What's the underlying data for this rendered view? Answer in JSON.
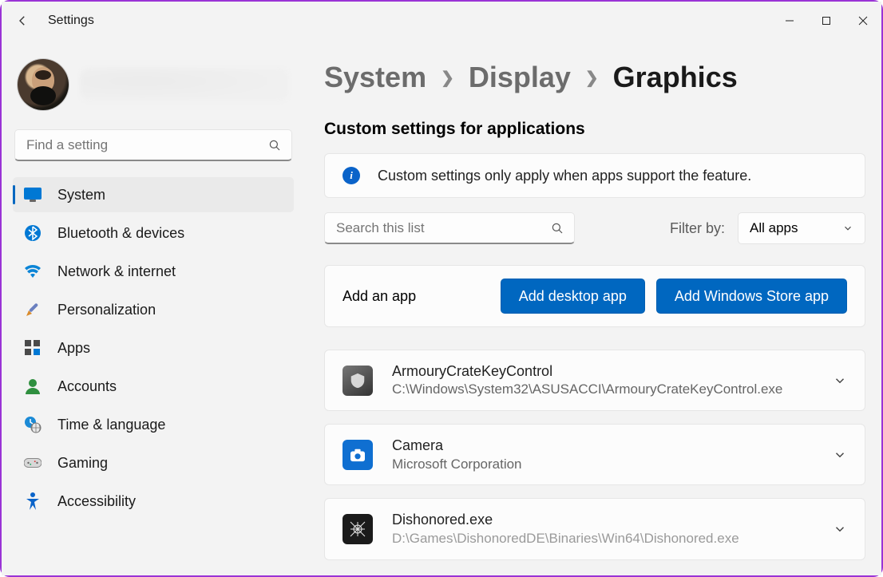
{
  "window": {
    "title": "Settings"
  },
  "search": {
    "placeholder": "Find a setting"
  },
  "sidebar": {
    "items": [
      {
        "id": "system",
        "label": "System",
        "selected": true
      },
      {
        "id": "bluetooth",
        "label": "Bluetooth & devices",
        "selected": false
      },
      {
        "id": "network",
        "label": "Network & internet",
        "selected": false
      },
      {
        "id": "personalization",
        "label": "Personalization",
        "selected": false
      },
      {
        "id": "apps",
        "label": "Apps",
        "selected": false
      },
      {
        "id": "accounts",
        "label": "Accounts",
        "selected": false
      },
      {
        "id": "time",
        "label": "Time & language",
        "selected": false
      },
      {
        "id": "gaming",
        "label": "Gaming",
        "selected": false
      },
      {
        "id": "accessibility",
        "label": "Accessibility",
        "selected": false
      }
    ]
  },
  "breadcrumb": {
    "root": "System",
    "middle": "Display",
    "current": "Graphics"
  },
  "section": {
    "title": "Custom settings for applications",
    "info_text": "Custom settings only apply when apps support the feature."
  },
  "list_search": {
    "placeholder": "Search this list"
  },
  "filter": {
    "label": "Filter by:",
    "selected": "All apps"
  },
  "add_panel": {
    "label": "Add an app",
    "desktop_btn": "Add desktop app",
    "store_btn": "Add Windows Store app"
  },
  "apps": [
    {
      "name": "ArmouryCrateKeyControl",
      "path": "C:\\Windows\\System32\\ASUSACCI\\ArmouryCrateKeyControl.exe",
      "icon": "shield"
    },
    {
      "name": "Camera",
      "path": "Microsoft Corporation",
      "icon": "camera"
    },
    {
      "name": "Dishonored.exe",
      "path": "D:\\Games\\DishonoredDE\\Binaries\\Win64\\Dishonored.exe",
      "icon": "skull"
    }
  ]
}
